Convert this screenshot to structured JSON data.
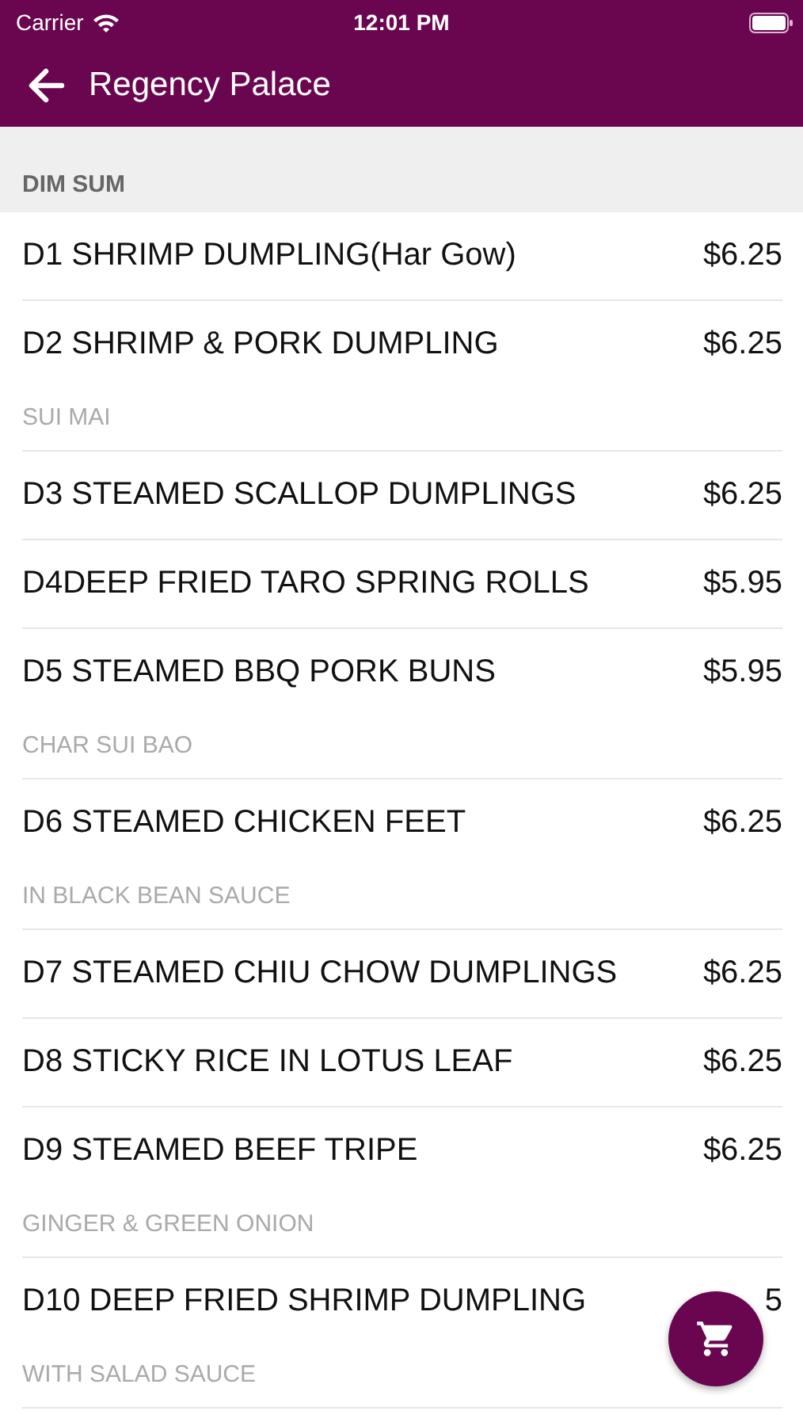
{
  "status_bar": {
    "carrier": "Carrier",
    "time": "12:01 PM"
  },
  "nav_bar": {
    "title": "Regency Palace"
  },
  "section": {
    "title": "DIM SUM"
  },
  "items": [
    {
      "name": "D1 SHRIMP DUMPLING(Har Gow)",
      "price": "$6.25"
    },
    {
      "name": "D2 SHRIMP & PORK DUMPLING",
      "price": "$6.25",
      "description": "SUI MAI"
    },
    {
      "name": "D3 STEAMED SCALLOP DUMPLINGS",
      "price": "$6.25"
    },
    {
      "name": "D4DEEP FRIED TARO SPRING ROLLS",
      "price": "$5.95"
    },
    {
      "name": "D5 STEAMED BBQ PORK BUNS",
      "price": "$5.95",
      "description": "CHAR SUI BAO"
    },
    {
      "name": "D6 STEAMED CHICKEN FEET",
      "price": "$6.25",
      "description": "IN BLACK BEAN SAUCE"
    },
    {
      "name": "D7 STEAMED CHIU CHOW DUMPLINGS",
      "price": "$6.25"
    },
    {
      "name": "D8 STICKY RICE IN LOTUS LEAF",
      "price": "$6.25"
    },
    {
      "name": "D9 STEAMED BEEF TRIPE",
      "price": "$6.25",
      "description": "GINGER & GREEN ONION"
    },
    {
      "name": "D10 DEEP FRIED SHRIMP DUMPLING",
      "price": "5",
      "description": "WITH SALAD SAUCE"
    }
  ]
}
